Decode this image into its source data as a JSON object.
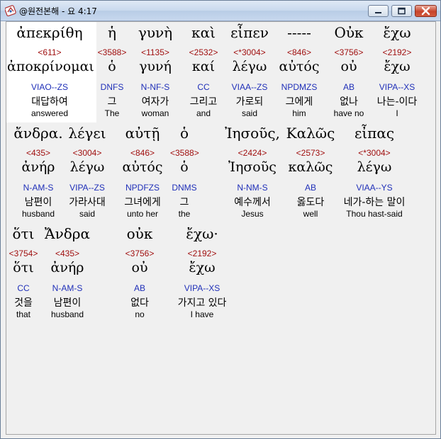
{
  "window": {
    "title": "@원전본해 - 요 4:17",
    "icon": "bible-app-icon",
    "controls": [
      "minimize-icon",
      "maximize-icon",
      "close-icon"
    ]
  },
  "colors": {
    "strongs_number": "#a01010",
    "parsing_code": "#1f2fb8",
    "text": "#000000",
    "selected_background": "#ffffff",
    "background": "#f0f0f0"
  },
  "rows": [
    [
      {
        "greek": "ἀπεκρίθη",
        "strongs": "<611>",
        "lemma": "ἀποκρίνομαι",
        "parse": "VIAO--ZS",
        "korean": "대답하여",
        "english": "answered",
        "selected": true
      },
      {
        "greek": "ἡ",
        "strongs": "<3588>",
        "lemma": "ὁ",
        "parse": "DNFS",
        "korean": "그",
        "english": "The"
      },
      {
        "greek": "γυνὴ",
        "strongs": "<1135>",
        "lemma": "γυνή",
        "parse": "N-NF-S",
        "korean": "여자가",
        "english": "woman"
      },
      {
        "greek": "καὶ",
        "strongs": "<2532>",
        "lemma": "καί",
        "parse": "CC",
        "korean": "그리고",
        "english": "and"
      },
      {
        "greek": "εἶπεν",
        "strongs": "<*3004>",
        "lemma": "λέγω",
        "parse": "VIAA--ZS",
        "korean": "가로되",
        "english": "said"
      },
      {
        "greek": "-----",
        "strongs": "<846>",
        "lemma": "αὐτός",
        "parse": "NPDMZS",
        "korean": "그에게",
        "english": "him"
      },
      {
        "greek": "Οὐκ",
        "strongs": "<3756>",
        "lemma": "οὐ",
        "parse": "AB",
        "korean": "없나",
        "english": "have no"
      },
      {
        "greek": "ἔχω",
        "strongs": "<2192>",
        "lemma": "ἔχω",
        "parse": "VIPA--XS",
        "korean": "나는-이다",
        "english": "I"
      }
    ],
    [
      {
        "greek": "ἄνδρα.",
        "strongs": "<435>",
        "lemma": "ἀνήρ",
        "parse": "N-AM-S",
        "korean": "남편이",
        "english": "husband"
      },
      {
        "greek": "λέγει",
        "strongs": "<3004>",
        "lemma": "λέγω",
        "parse": "VIPA--ZS",
        "korean": "가라사대",
        "english": "said"
      },
      {
        "greek": "αὐτῇ",
        "strongs": "<846>",
        "lemma": "αὐτός",
        "parse": "NPDFZS",
        "korean": "그녀에게",
        "english": "unto her"
      },
      {
        "greek": "ὁ",
        "strongs": "<3588>",
        "lemma": "ὁ",
        "parse": "DNMS",
        "korean": "그",
        "english": "the"
      },
      {
        "greek": "Ἰησοῦς,",
        "strongs": "<2424>",
        "lemma": "Ἰησοῦς",
        "parse": "N-NM-S",
        "korean": "예수께서",
        "english": "Jesus"
      },
      {
        "greek": "Καλῶς",
        "strongs": "<2573>",
        "lemma": "καλῶς",
        "parse": "AB",
        "korean": "옳도다",
        "english": "well"
      },
      {
        "greek": "εἶπας",
        "strongs": "<*3004>",
        "lemma": "λέγω",
        "parse": "VIAA--YS",
        "korean": "네가-하는 말이",
        "english": "Thou hast-said"
      }
    ],
    [
      {
        "greek": "ὅτι",
        "strongs": "<3754>",
        "lemma": "ὅτι",
        "parse": "CC",
        "korean": "것을",
        "english": "that"
      },
      {
        "greek": "Ἄνδρα",
        "strongs": "<435>",
        "lemma": "ἀνήρ",
        "parse": "N-AM-S",
        "korean": "남편이",
        "english": "husband"
      },
      {
        "greek": "οὐκ",
        "strongs": "<3756>",
        "lemma": "οὐ",
        "parse": "AB",
        "korean": "없다",
        "english": "no"
      },
      {
        "greek": "ἔχω·",
        "strongs": "<2192>",
        "lemma": "ἔχω",
        "parse": "VIPA--XS",
        "korean": "가지고 있다",
        "english": "I have"
      }
    ]
  ]
}
